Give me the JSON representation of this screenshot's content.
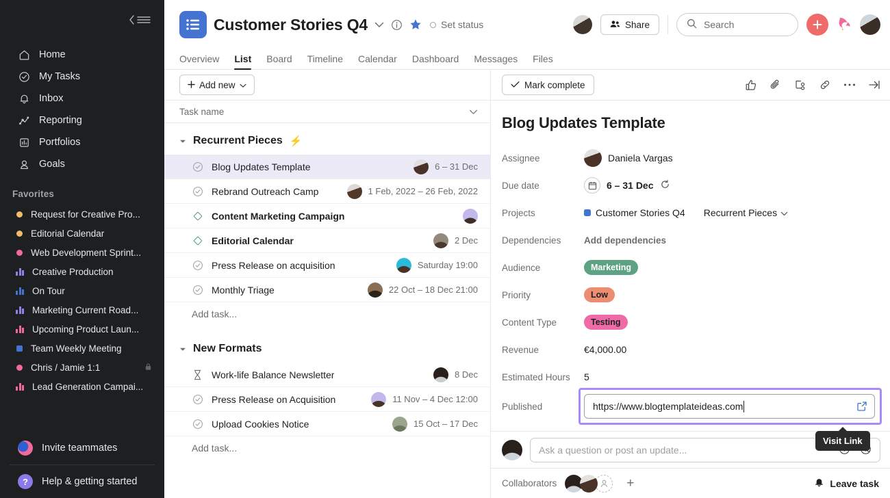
{
  "sidebar": {
    "collapse_icon": "collapse-sidebar-icon",
    "nav": [
      {
        "label": "Home",
        "icon": "home-icon"
      },
      {
        "label": "My Tasks",
        "icon": "check-circle-icon"
      },
      {
        "label": "Inbox",
        "icon": "bell-icon"
      },
      {
        "label": "Reporting",
        "icon": "line-chart-icon"
      },
      {
        "label": "Portfolios",
        "icon": "portfolio-icon"
      },
      {
        "label": "Goals",
        "icon": "goal-person-icon"
      }
    ],
    "favorites_title": "Favorites",
    "favorites": [
      {
        "label": "Request for Creative Pro...",
        "type": "dot",
        "color": "#f1bd6c"
      },
      {
        "label": "Editorial Calendar",
        "type": "dot",
        "color": "#f1bd6c"
      },
      {
        "label": "Web Development Sprint...",
        "type": "dot",
        "color": "#f06a9b"
      },
      {
        "label": "Creative Production",
        "type": "bars",
        "color": "#8d84e8"
      },
      {
        "label": "On Tour",
        "type": "bars",
        "color": "#4573d2"
      },
      {
        "label": "Marketing Current Road...",
        "type": "bars",
        "color": "#8d84e8"
      },
      {
        "label": "Upcoming Product Laun...",
        "type": "bars",
        "color": "#f06a9b"
      },
      {
        "label": "Team Weekly Meeting",
        "type": "dot",
        "color": "#4573d2"
      },
      {
        "label": "Chris / Jamie 1:1",
        "type": "dot",
        "color": "#f06a9b",
        "locked": true
      },
      {
        "label": "Lead Generation Campai...",
        "type": "bars",
        "color": "#f06a9b"
      }
    ],
    "invite": {
      "label": "Invite teammates",
      "icon": "invite-teammates-icon"
    },
    "help": {
      "label": "Help & getting started",
      "icon": "question-mark-icon",
      "glyph": "?"
    }
  },
  "header": {
    "project_icon": "list-project-icon",
    "title": "Customer Stories Q4",
    "chevron_icon": "chevron-down-icon",
    "info_icon": "info-circle-icon",
    "star_icon": "star-filled-icon",
    "set_status_label": "Set status",
    "share_label": "Share",
    "share_icon": "people-icon",
    "search_placeholder": "Search",
    "search_icon": "search-icon",
    "create_icon": "plus-icon",
    "mascot_icon": "asana-mascot-icon",
    "accent_blue": "#4573d2",
    "accent_red": "#f06a6a"
  },
  "tabs": [
    {
      "label": "Overview",
      "active": false
    },
    {
      "label": "List",
      "active": true
    },
    {
      "label": "Board",
      "active": false
    },
    {
      "label": "Timeline",
      "active": false
    },
    {
      "label": "Calendar",
      "active": false
    },
    {
      "label": "Dashboard",
      "active": false
    },
    {
      "label": "Messages",
      "active": false
    },
    {
      "label": "Files",
      "active": false
    }
  ],
  "list": {
    "add_new_label": "Add new",
    "add_new_icon": "plus-icon",
    "column_header": "Task name",
    "collapse_column_icon": "chevron-down-icon",
    "add_task_label": "Add task...",
    "sections": [
      {
        "name": "Recurrent Pieces",
        "badge_icon": "lightning-bolt-icon",
        "badge_glyph": "⚡",
        "tasks": [
          {
            "name": "Blog Updates Template",
            "icon": "check-circle-icon",
            "date": "6 – 31 Dec",
            "selected": true,
            "bold": false,
            "avatar": "#6b4f43"
          },
          {
            "name": "Rebrand Outreach Camp",
            "icon": "check-circle-icon",
            "date": "1 Feb, 2022 – 26 Feb, 2022",
            "selected": false,
            "bold": false,
            "avatar": "#7a5a4a"
          },
          {
            "name": "Content Marketing Campaign",
            "icon": "milestone-icon",
            "date": "",
            "selected": false,
            "bold": true,
            "avatar": "#b9aee6"
          },
          {
            "name": "Editorial Calendar",
            "icon": "milestone-icon",
            "date": "2 Dec",
            "selected": false,
            "bold": true,
            "avatar": "#8c8274"
          },
          {
            "name": "Press Release on acquisition",
            "icon": "check-circle-icon",
            "date": "Saturday 19:00",
            "selected": false,
            "bold": false,
            "avatar": "#2bbbd8"
          },
          {
            "name": "Monthly Triage",
            "icon": "check-circle-icon",
            "date": "22 Oct – 18 Dec 21:00",
            "selected": false,
            "bold": false,
            "avatar": "#4a4238"
          }
        ]
      },
      {
        "name": "New Formats",
        "badge_icon": "",
        "badge_glyph": "",
        "tasks": [
          {
            "name": "Work-life Balance Newsletter",
            "icon": "hourglass-icon",
            "date": "8 Dec",
            "selected": false,
            "bold": false,
            "avatar": "#3b2f2a"
          },
          {
            "name": "Press Release on Acquisition",
            "icon": "check-circle-icon",
            "date": "11 Nov – 4 Dec 12:00",
            "selected": false,
            "bold": false,
            "avatar": "#b9aee6"
          },
          {
            "name": "Upload Cookies Notice",
            "icon": "check-circle-icon",
            "date": "15 Oct – 17 Dec",
            "selected": false,
            "bold": false,
            "avatar": "#7d8a6e"
          }
        ]
      }
    ]
  },
  "detail": {
    "mark_complete_label": "Mark complete",
    "mark_complete_icon": "check-icon",
    "toolbar_icons": [
      {
        "name": "thumbs-up-icon"
      },
      {
        "name": "paperclip-icon"
      },
      {
        "name": "subtask-icon"
      },
      {
        "name": "link-icon"
      },
      {
        "name": "more-options-icon"
      },
      {
        "name": "collapse-panel-icon"
      }
    ],
    "title": "Blog Updates Template",
    "fields": {
      "assignee_label": "Assignee",
      "assignee_name": "Daniela Vargas",
      "due_date_label": "Due date",
      "due_date_value": "6 – 31 Dec",
      "due_date_icon": "calendar-icon",
      "recurring_icon": "repeat-icon",
      "projects_label": "Projects",
      "project_name": "Customer Stories Q4",
      "project_color": "#4573d2",
      "project_section": "Recurrent Pieces",
      "dependencies_label": "Dependencies",
      "dependencies_value": "Add dependencies",
      "audience_label": "Audience",
      "audience_value": "Marketing",
      "audience_bg": "#5da283",
      "audience_fg": "#ffffff",
      "priority_label": "Priority",
      "priority_value": "Low",
      "priority_bg": "#ec8d71",
      "priority_fg": "#1e1f21",
      "content_type_label": "Content Type",
      "content_type_value": "Testing",
      "content_type_bg": "#ef6ba8",
      "content_type_fg": "#1e1f21",
      "revenue_label": "Revenue",
      "revenue_value": "€4,000.00",
      "estimated_hours_label": "Estimated Hours",
      "estimated_hours_value": "5",
      "published_label": "Published",
      "published_value": "https://www.blogtemplateideas.com",
      "published_visit_icon": "external-link-icon",
      "highlight_color": "#a78bfa"
    },
    "tooltip": "Visit Link",
    "comment_placeholder": "Ask a question or post an update...",
    "comment_icons": [
      {
        "name": "record-icon"
      },
      {
        "name": "mention-icon"
      }
    ],
    "collaborators_label": "Collaborators",
    "add_collaborator_icon": "add-person-icon",
    "add_collaborator_plus": "+",
    "leave_task_label": "Leave task",
    "leave_task_icon": "bell-icon"
  }
}
